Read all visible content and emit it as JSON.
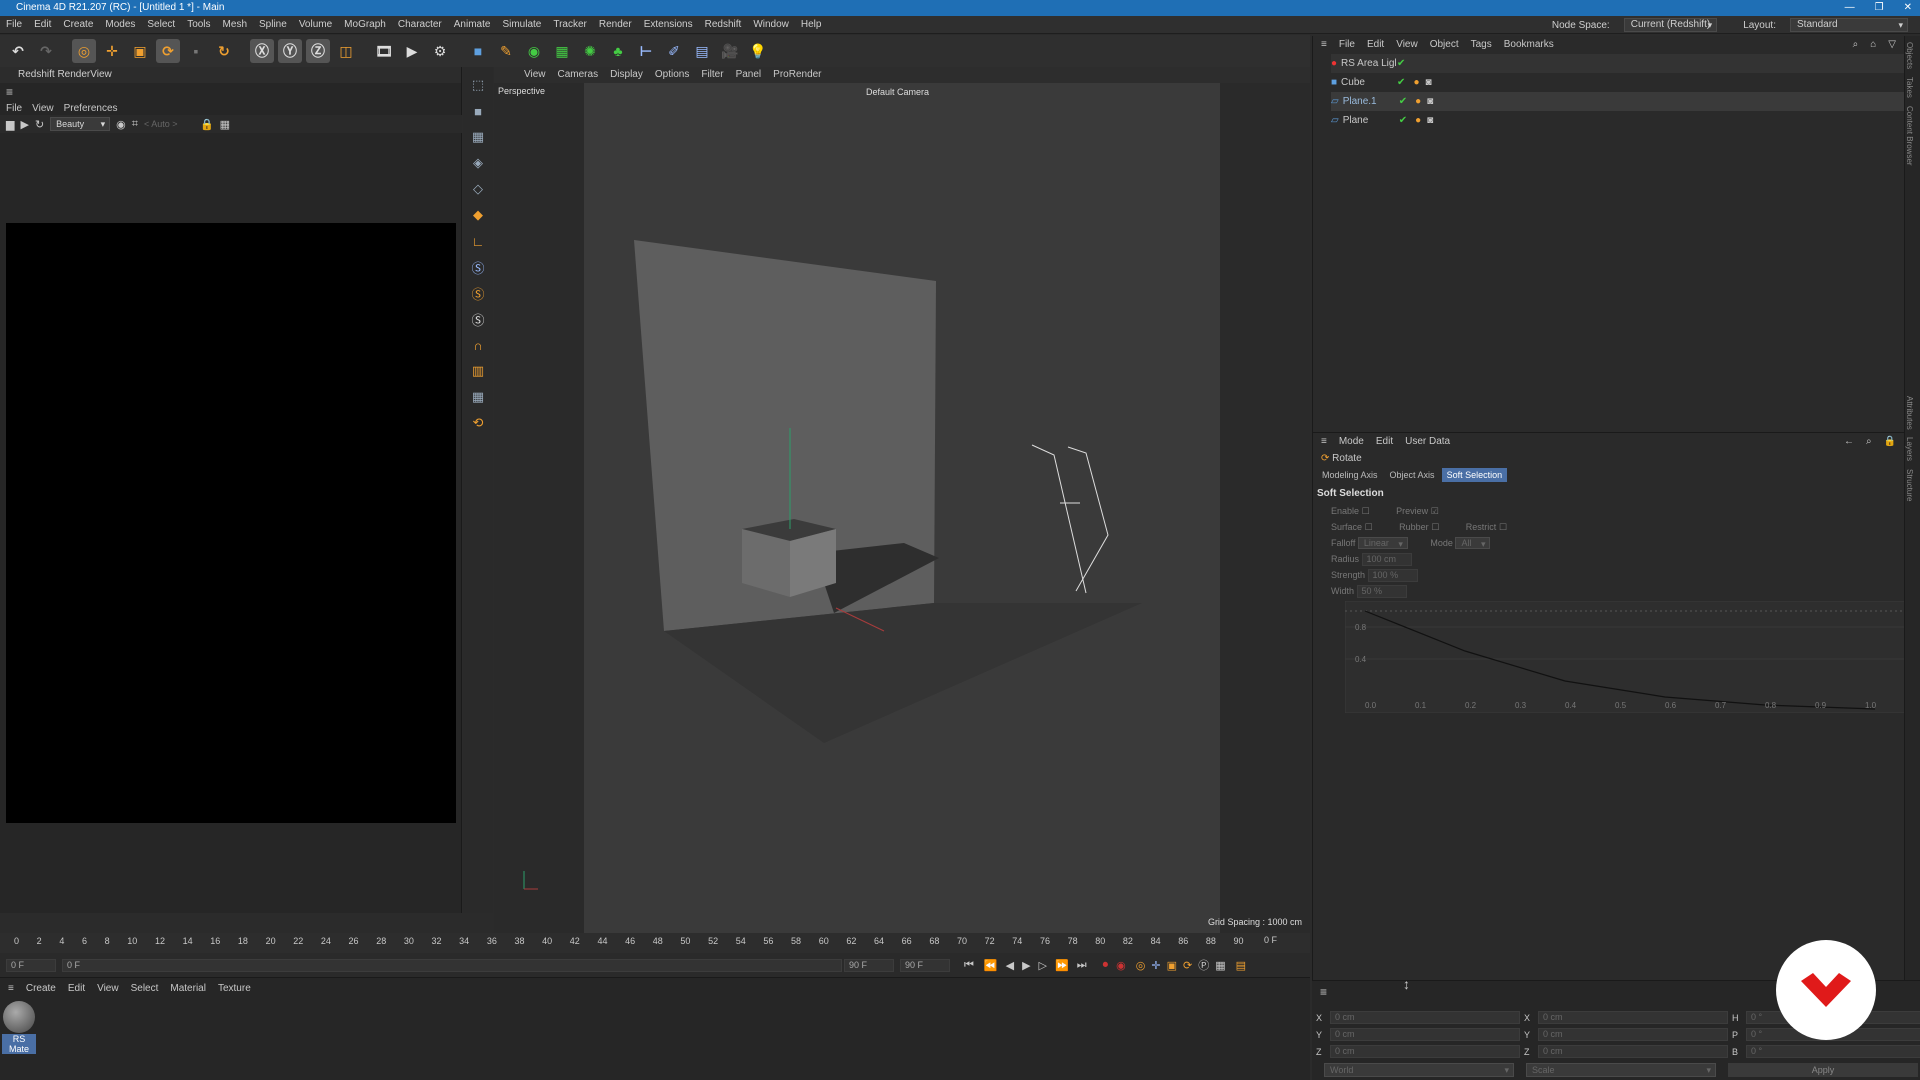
{
  "title": "Cinema 4D R21.207 (RC) - [Untitled 1 *] - Main",
  "menu": [
    "File",
    "Edit",
    "Create",
    "Modes",
    "Select",
    "Tools",
    "Mesh",
    "Spline",
    "Volume",
    "MoGraph",
    "Character",
    "Animate",
    "Simulate",
    "Tracker",
    "Render",
    "Extensions",
    "Redshift",
    "Window",
    "Help"
  ],
  "node_space_label": "Node Space:",
  "node_space_value": "Current (Redshift)",
  "layout_label": "Layout:",
  "layout_value": "Standard",
  "toolbar_icons": [
    "undo-icon",
    "redo-icon",
    "move-icon",
    "scale-icon",
    "rotate-icon",
    "xaxis-icon",
    "yaxis-icon",
    "zaxis-icon",
    "world-icon",
    "render-region-icon",
    "render-view-icon",
    "render-settings-icon",
    "cube-icon",
    "pen-icon",
    "subdivision-icon",
    "extrude-icon",
    "cloner-icon",
    "array-icon",
    "deformer-icon",
    "floor-icon",
    "camera-icon",
    "light-icon"
  ],
  "renderview": {
    "title": "Redshift RenderView",
    "menu": [
      "File",
      "View",
      "Preferences"
    ],
    "beauty": "Beauty",
    "auto": "< Auto >"
  },
  "viewport": {
    "menu": [
      "View",
      "Cameras",
      "Display",
      "Options",
      "Filter",
      "Panel",
      "ProRender"
    ],
    "label": "Perspective",
    "camera": "Default Camera",
    "grid": "Grid Spacing : 1000 cm"
  },
  "timeline": {
    "ticks": [
      "0",
      "2",
      "4",
      "6",
      "8",
      "10",
      "12",
      "14",
      "16",
      "18",
      "20",
      "22",
      "24",
      "26",
      "28",
      "30",
      "32",
      "34",
      "36",
      "38",
      "40",
      "42",
      "44",
      "46",
      "48",
      "50",
      "52",
      "54",
      "56",
      "58",
      "60",
      "62",
      "64",
      "66",
      "68",
      "70",
      "72",
      "74",
      "76",
      "78",
      "80",
      "82",
      "84",
      "86",
      "88",
      "90"
    ],
    "frame": "0 F",
    "start": "0 F",
    "cur": "0 F",
    "end1": "90 F",
    "end2": "90 F"
  },
  "material": {
    "menu": [
      "Create",
      "Edit",
      "View",
      "Select",
      "Material",
      "Texture"
    ],
    "name": "RS Mate"
  },
  "objects": {
    "menu": [
      "File",
      "Edit",
      "View",
      "Object",
      "Tags",
      "Bookmarks"
    ],
    "items": [
      "RS Area Ligl",
      "Cube",
      "Plane.1",
      "Plane"
    ]
  },
  "attributes": {
    "menu": [
      "Mode",
      "Edit",
      "User Data"
    ],
    "tool": "Rotate",
    "tabs": [
      "Modeling Axis",
      "Object Axis",
      "Soft Selection"
    ],
    "section": "Soft Selection",
    "enable": "Enable",
    "preview": "Preview",
    "surface": "Surface",
    "rubber": "Rubber",
    "restrict": "Restrict",
    "falloff": "Falloff",
    "falloff_val": "Linear",
    "mode": "Mode",
    "mode_val": "All",
    "radius": "Radius",
    "radius_val": "100 cm",
    "strength": "Strength",
    "strength_val": "100 %",
    "width": "Width",
    "width_val": "50 %",
    "graph_y": [
      "0.8",
      "0.4"
    ],
    "graph_x": [
      "0.0",
      "0.1",
      "0.2",
      "0.3",
      "0.4",
      "0.5",
      "0.6",
      "0.7",
      "0.8",
      "0.9",
      "1.0"
    ]
  },
  "coords": {
    "labels": [
      "X",
      "Y",
      "Z",
      "X",
      "Y",
      "Z",
      "H",
      "P",
      "B"
    ],
    "val": "0 cm",
    "ang": "0 °",
    "world": "World",
    "scale": "Scale",
    "apply": "Apply"
  },
  "side_tabs": [
    "Objects",
    "Takes",
    "Content Browser",
    "Attributes",
    "Layers",
    "Structure"
  ]
}
